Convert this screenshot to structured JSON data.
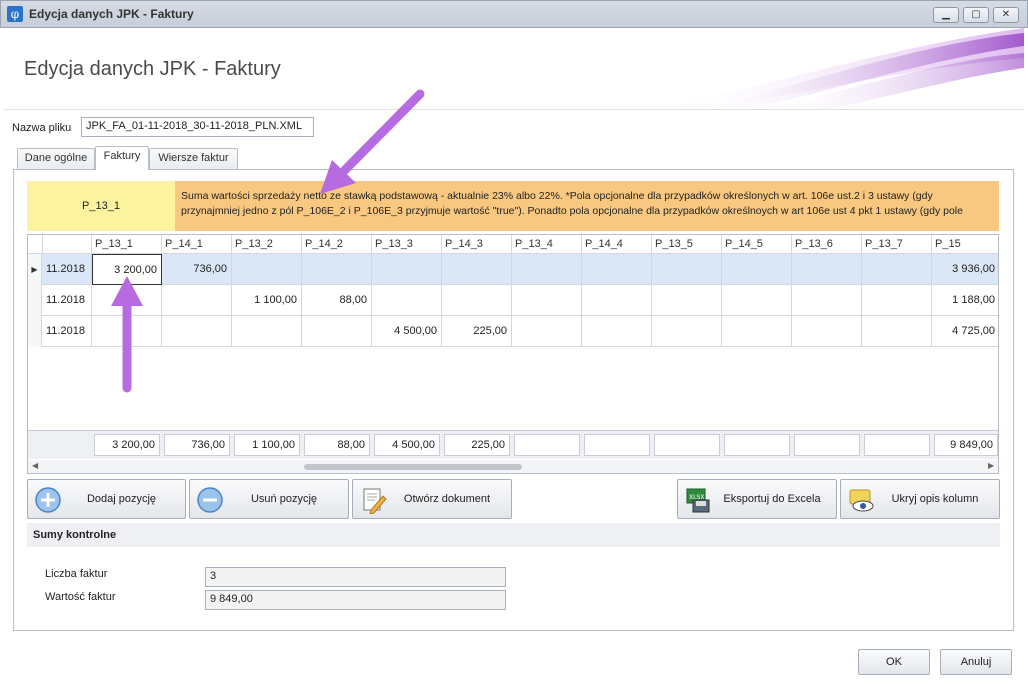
{
  "window": {
    "title": "Edycja danych JPK - Faktury"
  },
  "header": {
    "title": "Edycja danych JPK - Faktury"
  },
  "file": {
    "label": "Nazwa pliku",
    "value": "JPK_FA_01-11-2018_30-11-2018_PLN.XML"
  },
  "tabs": [
    {
      "label": "Dane ogólne"
    },
    {
      "label": "Faktury"
    },
    {
      "label": "Wiersze faktur"
    }
  ],
  "description": {
    "field": "P_13_1",
    "text": "Suma wartości sprzedaży netto ze stawką podstawową - aktualnie 23% albo 22%.  *Pola opcjonalne dla przypadków określonych w art. 106e ust.2 i 3 ustawy (gdy przynajmniej jedno z pól P_106E_2 i P_106E_3 przyjmuje wartość \"true\"). Ponadto pola opcjonalne dla przypadków określnoych w art 106e ust 4 pkt 1 ustawy (gdy pole"
  },
  "grid": {
    "columns": [
      "",
      "P_13_1",
      "P_14_1",
      "P_13_2",
      "P_14_2",
      "P_13_3",
      "P_14_3",
      "P_13_4",
      "P_14_4",
      "P_13_5",
      "P_14_5",
      "P_13_6",
      "P_13_7",
      "P_15"
    ],
    "rows": [
      [
        "11.2018",
        "3 200,00",
        "736,00",
        "",
        "",
        "",
        "",
        "",
        "",
        "",
        "",
        "",
        "",
        "3 936,00"
      ],
      [
        "11.2018",
        "",
        "",
        "1 100,00",
        "88,00",
        "",
        "",
        "",
        "",
        "",
        "",
        "",
        "",
        "1 188,00"
      ],
      [
        "11.2018",
        "",
        "",
        "",
        "",
        "4 500,00",
        "225,00",
        "",
        "",
        "",
        "",
        "",
        "",
        "4 725,00"
      ]
    ],
    "totals": [
      "3 200,00",
      "736,00",
      "1 100,00",
      "88,00",
      "4 500,00",
      "225,00",
      "",
      "",
      "",
      "",
      "",
      "",
      "9 849,00"
    ]
  },
  "buttons": {
    "add": "Dodaj pozycję",
    "remove": "Usuń pozycję",
    "open": "Otwórz dokument",
    "export": "Eksportuj do Excela",
    "hide": "Ukryj opis kolumn"
  },
  "sums": {
    "title": "Sumy kontrolne",
    "count_label": "Liczba faktur",
    "count_value": "3",
    "value_label": "Wartość faktur",
    "value_value": "9 849,00"
  },
  "footer": {
    "ok": "OK",
    "cancel": "Anuluj"
  },
  "icons": {
    "app": "phi-logo-icon",
    "add": "plus-circle-icon",
    "remove": "minus-circle-icon",
    "open": "document-pencil-icon",
    "export": "excel-export-icon",
    "hide": "eye-icon"
  },
  "colors": {
    "desc_field_bg": "#fbf3a0",
    "desc_text_bg": "#f9c880",
    "selected_row": "#dbe7f7",
    "annotation_arrow": "#b76be0"
  }
}
